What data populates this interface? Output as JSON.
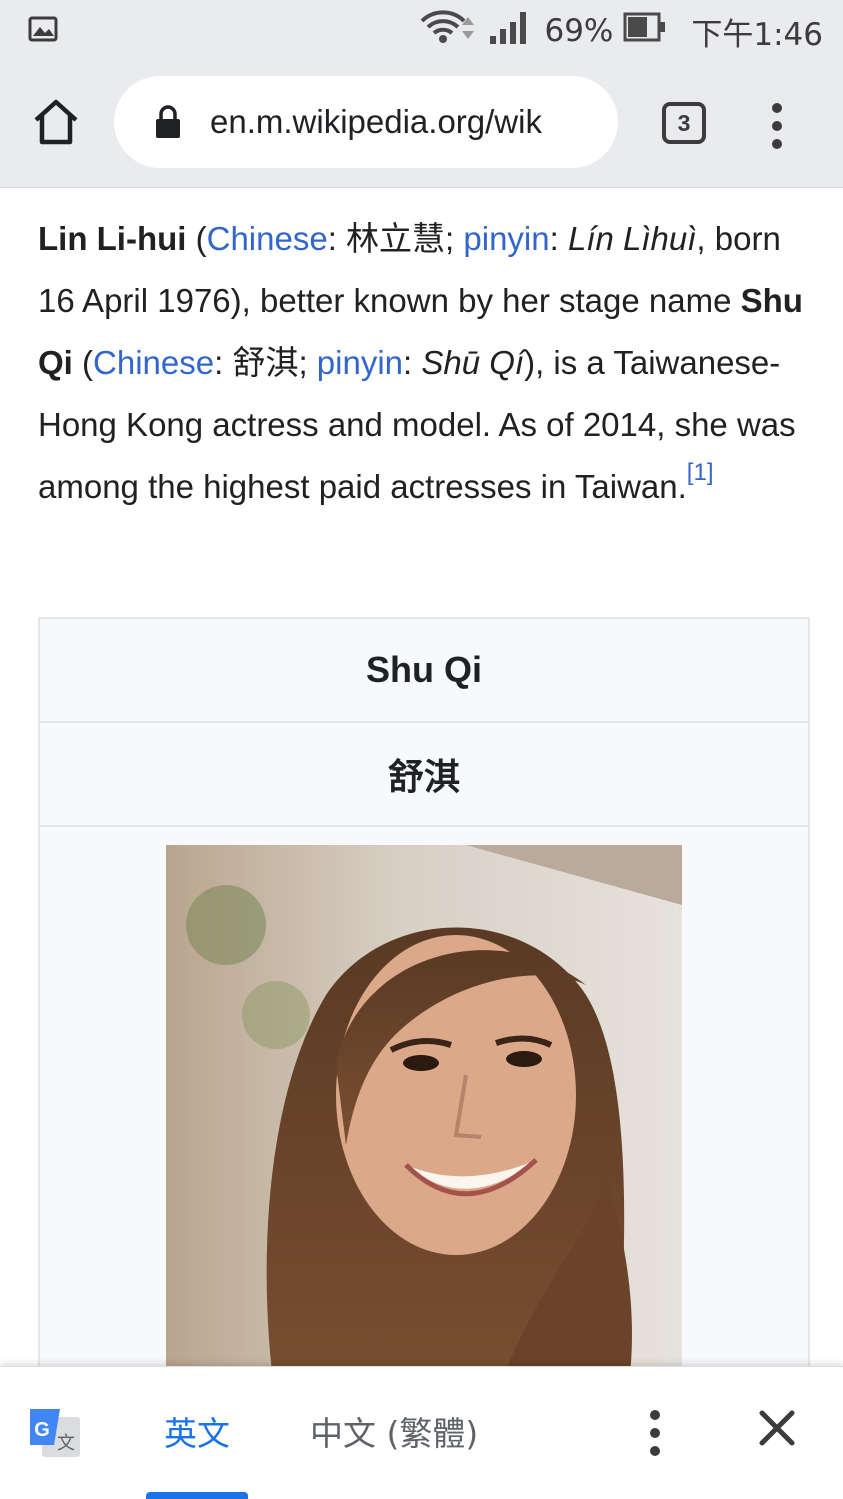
{
  "status_bar": {
    "battery_percent": "69%",
    "time": "下午1:46",
    "icons": [
      "gallery-notification-icon",
      "wifi-icon",
      "signal-icon",
      "battery-icon"
    ]
  },
  "browser": {
    "url": "en.m.wikipedia.org/wik",
    "tab_count": "3",
    "icons": [
      "home-icon",
      "lock-icon",
      "more-vert-icon"
    ]
  },
  "article": {
    "name": "Lin Li-hui",
    "chinese_link": "Chinese",
    "chinese_name": "林立慧",
    "pinyin_link": "pinyin",
    "pinyin_name": "Lín Lìhuì",
    "born_text": ", born 16 April 1976), better known by her stage name ",
    "stage_name": "Shu Qi",
    "chinese_link_2": "Chinese",
    "stage_chinese": "舒淇",
    "pinyin_link_2": "pinyin",
    "stage_pinyin": "Shū Qí",
    "rest_1": "), is a Taiwanese-Hong Kong actress and model. As of 2014, she was among the highest paid actresses in Taiwan.",
    "footnote": "[1]"
  },
  "infobox": {
    "title": "Shu Qi",
    "chinese_title": "舒淇"
  },
  "translate_bar": {
    "source_lang": "英文",
    "target_lang": "中文 (繁體)",
    "active_color": "#1a73e8",
    "icons": [
      "google-translate-icon",
      "more-vert-icon",
      "close-icon"
    ]
  }
}
